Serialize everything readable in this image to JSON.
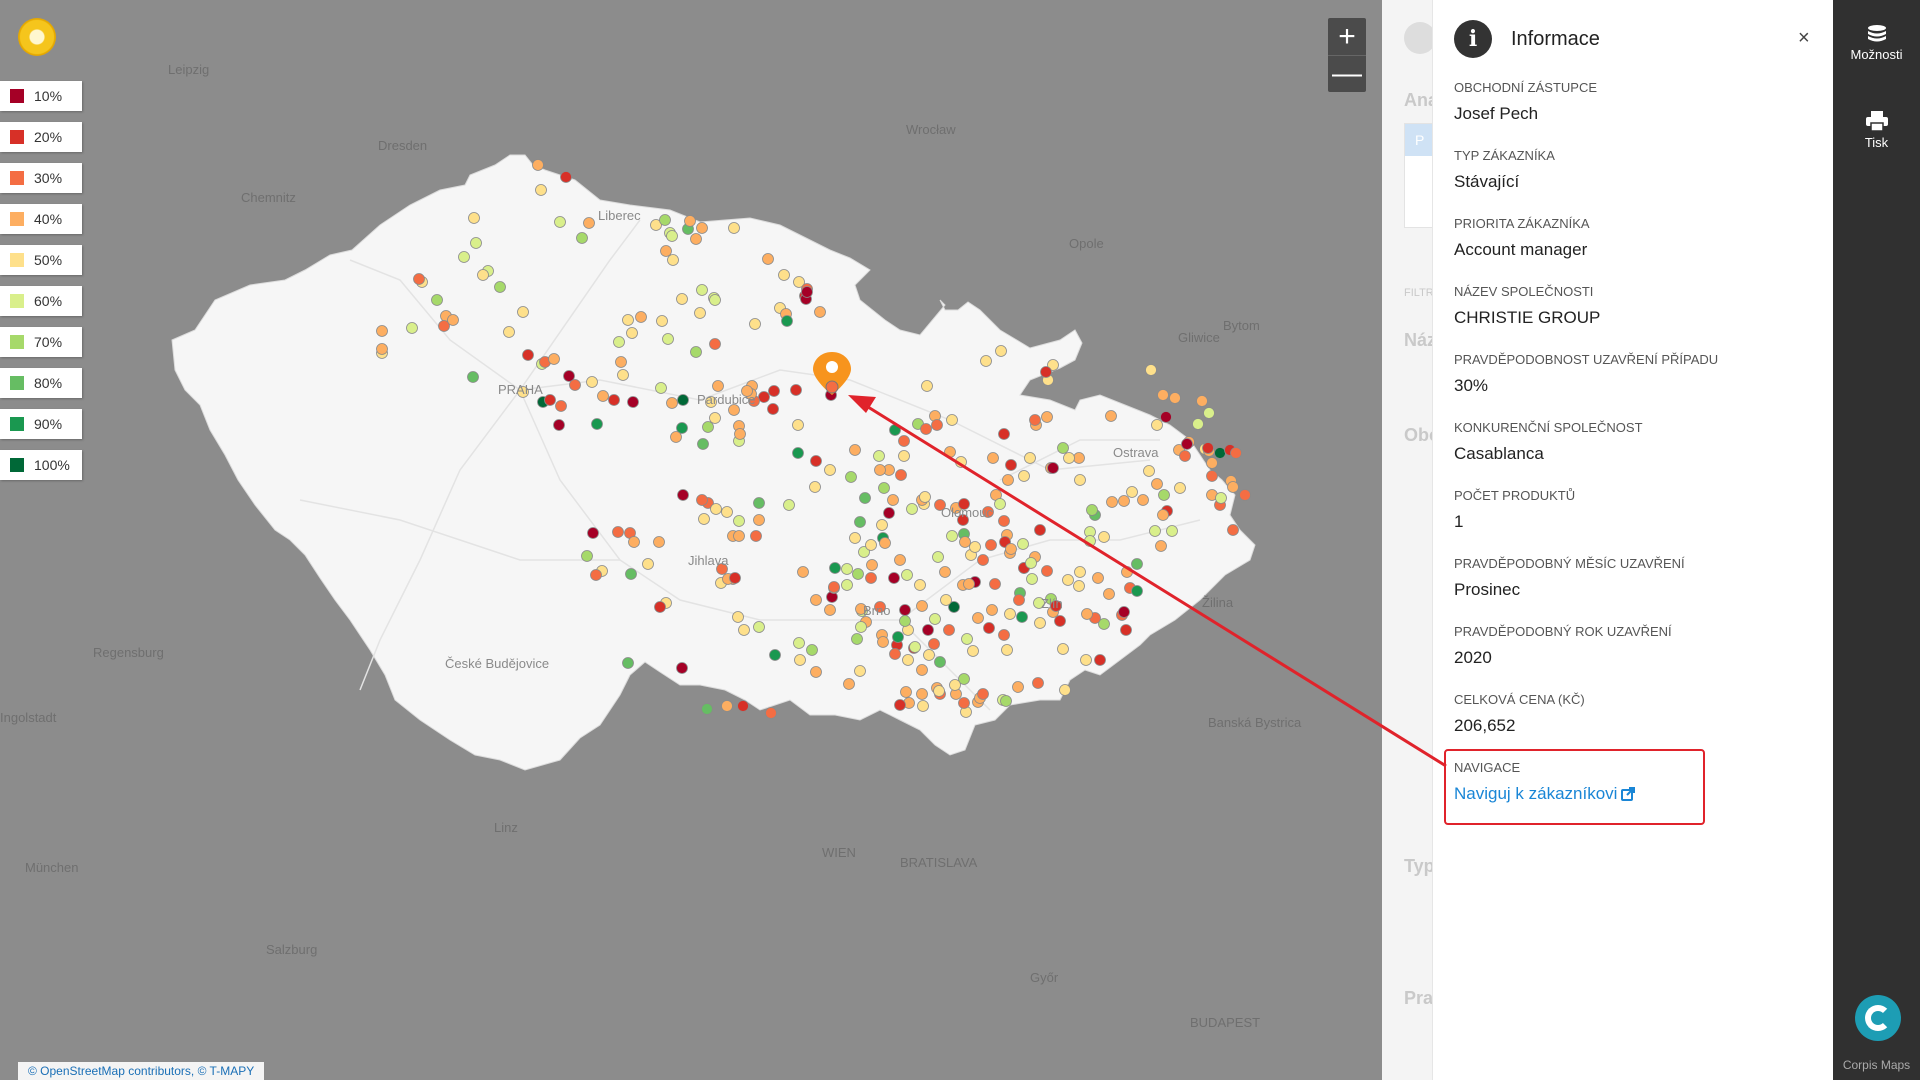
{
  "map": {
    "attribution": "© OpenStreetMap contributors, © T-MAPY",
    "cities_outside": [
      "Leipzig",
      "Dresden",
      "Chemnitz",
      "Wrocław",
      "Opole",
      "Gliwice",
      "Bytom",
      "Regensburg",
      "Ingolstadt",
      "Linz",
      "München",
      "Salzburg",
      "WIEN",
      "BRATISLAVA",
      "Győr",
      "BUDAPEST",
      "Banská Bystrica",
      "Žilina"
    ],
    "cities_inside": [
      "Liberec",
      "PRAHA",
      "Pardubice",
      "Jihlava",
      "Olomouc",
      "Ostrava",
      "Zlín",
      "Brno",
      "České Budějovice"
    ],
    "colors": {
      "10": "#a50026",
      "20": "#d73027",
      "30": "#f46d43",
      "40": "#fdae61",
      "50": "#fee08b",
      "60": "#d9ef8b",
      "70": "#a6d96a",
      "80": "#66bd63",
      "90": "#1a9850",
      "100": "#006837"
    },
    "selected_marker_color": "#f7941d"
  },
  "legend": [
    {
      "label": "10%",
      "color": "#a50026"
    },
    {
      "label": "20%",
      "color": "#d73027"
    },
    {
      "label": "30%",
      "color": "#f46d43"
    },
    {
      "label": "40%",
      "color": "#fdae61"
    },
    {
      "label": "50%",
      "color": "#fee08b"
    },
    {
      "label": "60%",
      "color": "#d9ef8b"
    },
    {
      "label": "70%",
      "color": "#a6d96a"
    },
    {
      "label": "80%",
      "color": "#66bd63"
    },
    {
      "label": "90%",
      "color": "#1a9850"
    },
    {
      "label": "100%",
      "color": "#006837"
    }
  ],
  "zoom": {
    "in": "+",
    "out": "—"
  },
  "peek": {
    "a": "Ana",
    "b": "P",
    "c": "FILTR",
    "d": "Náz",
    "e": "Obc",
    "f": "Typ",
    "g": "Pra"
  },
  "panel": {
    "title": "Informace",
    "close": "×",
    "fields": [
      {
        "label": "Obchodní zástupce",
        "value": "Josef Pech"
      },
      {
        "label": "Typ zákazníka",
        "value": "Stávající"
      },
      {
        "label": "Priorita zákazníka",
        "value": "Account manager"
      },
      {
        "label": "Název společnosti",
        "value": "CHRISTIE GROUP"
      },
      {
        "label": "Pravděpodobnost uzavření případu",
        "value": "30%"
      },
      {
        "label": "Konkurenční společnost",
        "value": "Casablanca"
      },
      {
        "label": "Počet produktů",
        "value": "1"
      },
      {
        "label": "Pravděpodobný měsíc uzavření",
        "value": "Prosinec"
      },
      {
        "label": "Pravděpodobný rok uzavření",
        "value": "2020"
      },
      {
        "label": "Celková cena (Kč)",
        "value": "206,652"
      }
    ],
    "navigation": {
      "label": "Navigace",
      "link": "Naviguj k zákazníkovi"
    }
  },
  "sidebar": {
    "options": "Možnosti",
    "print": "Tisk",
    "brand": "Corpis Maps"
  }
}
